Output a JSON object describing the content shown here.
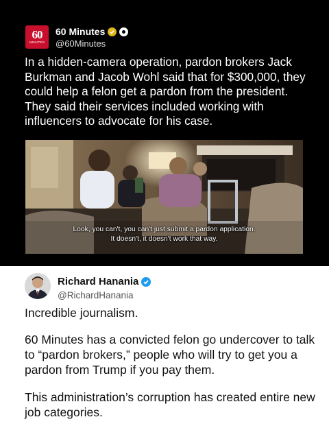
{
  "top_post": {
    "logo": {
      "number": "60",
      "subtext": "MINUTES"
    },
    "author": "60 Minutes",
    "handle": "@60Minutes",
    "text": "In a hidden-camera operation, pardon brokers Jack Burkman and Jacob Wohl said that for $300,000, they could help a felon get a pardon from the president. They said their services included working with influencers to advocate for his case.",
    "badge_icon": "verified-gold-badge-icon",
    "affiliate_icon": "cbs-eye-icon",
    "video": {
      "caption_line1": "Look, you can't, you can't just submit a pardon application.",
      "caption_line2": "It doesn't, it doesn't work that way."
    }
  },
  "bottom_post": {
    "author": "Richard Hanania",
    "handle": "@RichardHanania",
    "badge_icon": "verified-blue-badge-icon",
    "paragraphs": [
      "Incredible journalism.",
      "60 Minutes has a convicted felon go undercover to talk to “pardon brokers,” people who will try to get you a pardon from Trump if you pay them.",
      "This administration’s corruption has created entire new job categories."
    ]
  },
  "colors": {
    "logo_red": "#c8102e",
    "gold_badge": "#e2b719",
    "blue_badge": "#1d9bf0"
  }
}
